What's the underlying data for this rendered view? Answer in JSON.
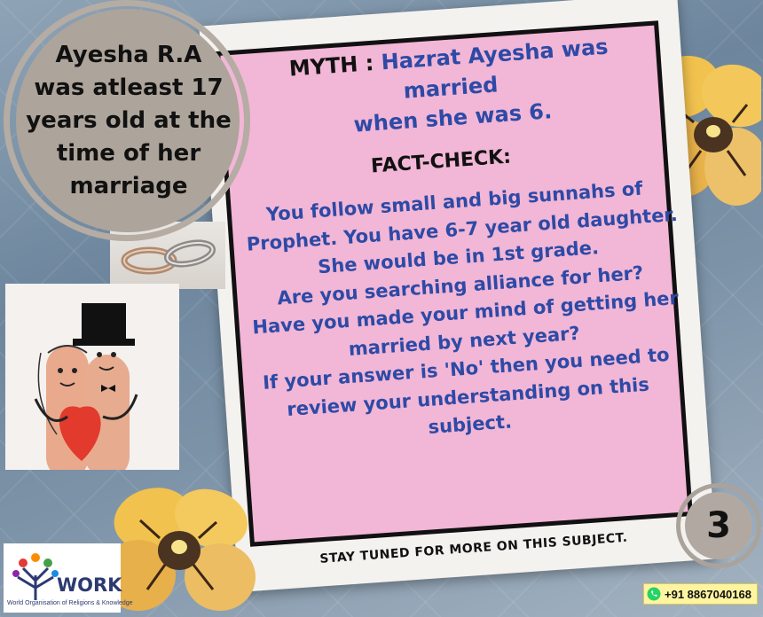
{
  "title_circle": {
    "lines": [
      "Ayesha R.A",
      "was atleast 17",
      "years old at the",
      "time of her",
      "marriage"
    ]
  },
  "myth": {
    "label": "MYTH :",
    "text_line1": "Hazrat Ayesha was married",
    "text_line2": "when she was 6."
  },
  "fact_check": {
    "label": "FACT-CHECK:",
    "lines": [
      "You follow small and big sunnahs of",
      "Prophet. You have 6-7 year old daughter.",
      "She would be in 1st grade.",
      "Are you searching alliance for her?",
      "Have you made your mind of getting her",
      "married by next year?",
      "If your answer is 'No' then you need to",
      "review your understanding on this",
      "subject."
    ]
  },
  "footer": {
    "stay_tuned": "STAY TUNED FOR MORE ON THIS SUBJECT.",
    "page_number": "3",
    "phone": "+91 8867040168"
  },
  "logo": {
    "name": "WORK",
    "subtitle": "World Organisation of Religions & Knowledge"
  },
  "colors": {
    "card_pink": "#f2b6d6",
    "text_blue": "#2d4aa6",
    "circle_grey": "#ada49b"
  },
  "icons": [
    "whatsapp-icon",
    "wedding-rings-photo",
    "finger-couple-photo",
    "pansy-flower"
  ]
}
